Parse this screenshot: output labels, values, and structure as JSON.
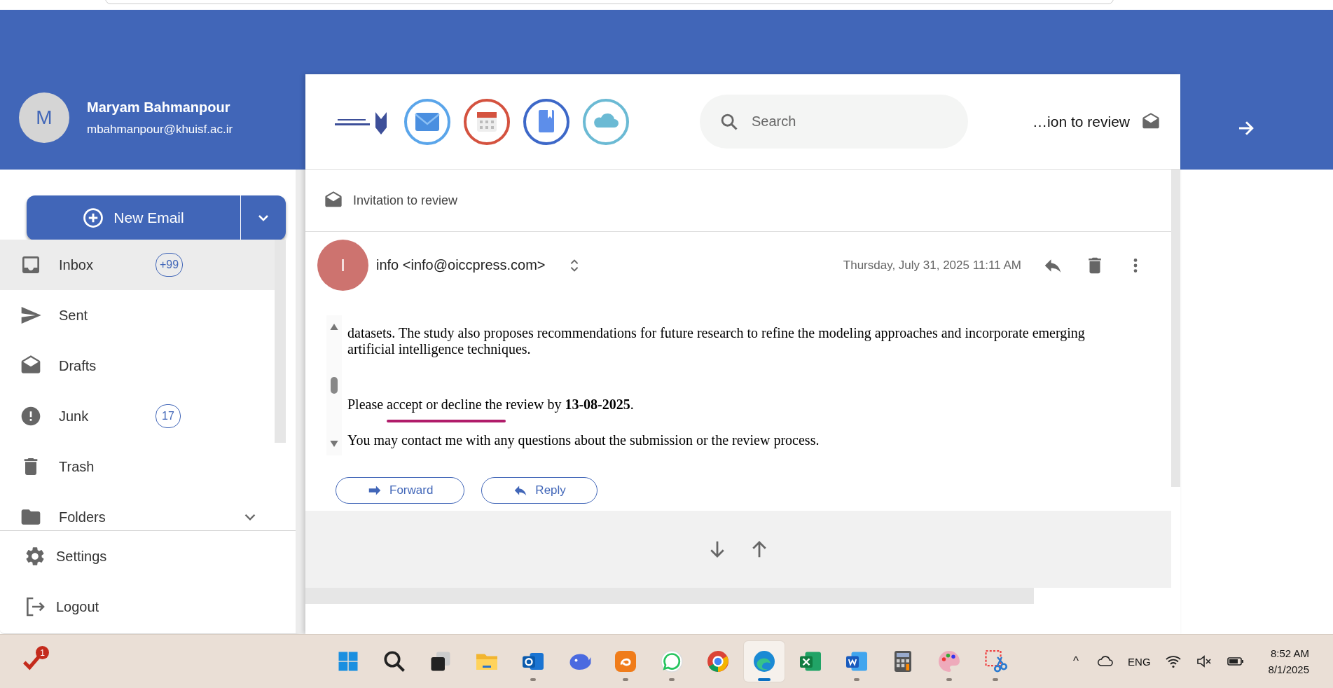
{
  "account": {
    "initial": "M",
    "name": "Maryam Bahmanpour",
    "email": "mbahmanpour@khuisf.ac.ir"
  },
  "search": {
    "placeholder": "Search"
  },
  "open_tab": {
    "title": "…ion to review"
  },
  "compose": {
    "label": "New Email"
  },
  "folders": [
    {
      "label": "Inbox",
      "kind": "inbox",
      "badge": "+99",
      "selected": true,
      "expandable": false
    },
    {
      "label": "Sent",
      "kind": "sent",
      "selected": false,
      "expandable": false
    },
    {
      "label": "Drafts",
      "kind": "drafts",
      "selected": false,
      "expandable": false
    },
    {
      "label": "Junk",
      "kind": "junk",
      "badge": "17",
      "selected": false,
      "expandable": false
    },
    {
      "label": "Trash",
      "kind": "trash",
      "selected": false,
      "expandable": false
    },
    {
      "label": "Folders",
      "kind": "folders",
      "selected": false,
      "expandable": true
    }
  ],
  "footer_links": [
    {
      "label": "Settings",
      "kind": "settings"
    },
    {
      "label": "Logout",
      "kind": "logout"
    }
  ],
  "message": {
    "subject": "Invitation to review",
    "sender_initial": "I",
    "sender": "info <info@oiccpress.com>",
    "date": "Thursday, July 31, 2025 11:11 AM",
    "body": [
      "datasets. The study also proposes recommendations for future research to refine the modeling approaches and incorporate emerging artificial intelligence techniques.",
      "Please accept or decline the review by **13-08-2025**.",
      "You may contact me with any questions about the submission or the review process."
    ],
    "actions": [
      "Forward",
      "Reply"
    ]
  },
  "taskbar": {
    "notification_badge": "1",
    "apps": [
      {
        "kind": "start",
        "running": false,
        "selected": false
      },
      {
        "kind": "search",
        "running": false,
        "selected": false
      },
      {
        "kind": "taskview",
        "running": false,
        "selected": false
      },
      {
        "kind": "files",
        "running": false,
        "selected": false
      },
      {
        "kind": "mailapp",
        "running": true,
        "selected": false
      },
      {
        "kind": "whale",
        "running": false,
        "selected": false
      },
      {
        "kind": "edu",
        "running": true,
        "selected": false
      },
      {
        "kind": "chat",
        "running": true,
        "selected": false
      },
      {
        "kind": "browser",
        "running": false,
        "selected": false
      },
      {
        "kind": "edge",
        "running": true,
        "selected": true
      },
      {
        "kind": "sheet",
        "running": false,
        "selected": false
      },
      {
        "kind": "doc",
        "running": true,
        "selected": false
      },
      {
        "kind": "calc",
        "running": false,
        "selected": false
      },
      {
        "kind": "paint",
        "running": true,
        "selected": false
      },
      {
        "kind": "snip",
        "running": true,
        "selected": false
      }
    ],
    "tray": {
      "overflow": "^",
      "language": "ENG",
      "time": "8:52 AM",
      "date": "8/1/2025"
    }
  }
}
